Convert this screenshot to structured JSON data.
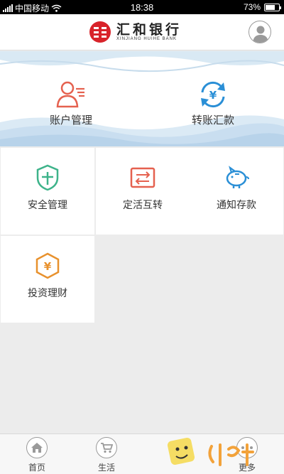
{
  "status_bar": {
    "carrier": "中国移动",
    "time": "18:38",
    "battery": "73%",
    "battery_level": 0.73
  },
  "header": {
    "logo_cn": "汇和银行",
    "logo_en": "XINJIANG HUIHE BANK",
    "user_icon": "user-icon"
  },
  "banner": {
    "items": [
      {
        "label": "账户管理",
        "icon": "account-icon",
        "color": "#e5614f"
      },
      {
        "label": "转账汇款",
        "icon": "transfer-icon",
        "color": "#2a8fd6"
      }
    ]
  },
  "grid": {
    "items": [
      {
        "label": "安全管理",
        "icon": "shield-icon",
        "color": "#3db38a"
      },
      {
        "label": "定活互转",
        "icon": "swap-icon",
        "color": "#e5614f"
      },
      {
        "label": "通知存款",
        "icon": "piggy-bank-icon",
        "color": "#2a8fd6"
      },
      {
        "label": "投资理财",
        "icon": "investment-icon",
        "color": "#e8912d"
      }
    ]
  },
  "tabbar": {
    "tabs": [
      {
        "label": "首页",
        "icon": "home-icon"
      },
      {
        "label": "生活",
        "icon": "cart-icon"
      },
      {
        "label": "更多",
        "icon": "more-icon"
      }
    ]
  },
  "colors": {
    "brand_red": "#d8232a",
    "background": "#ececec"
  }
}
